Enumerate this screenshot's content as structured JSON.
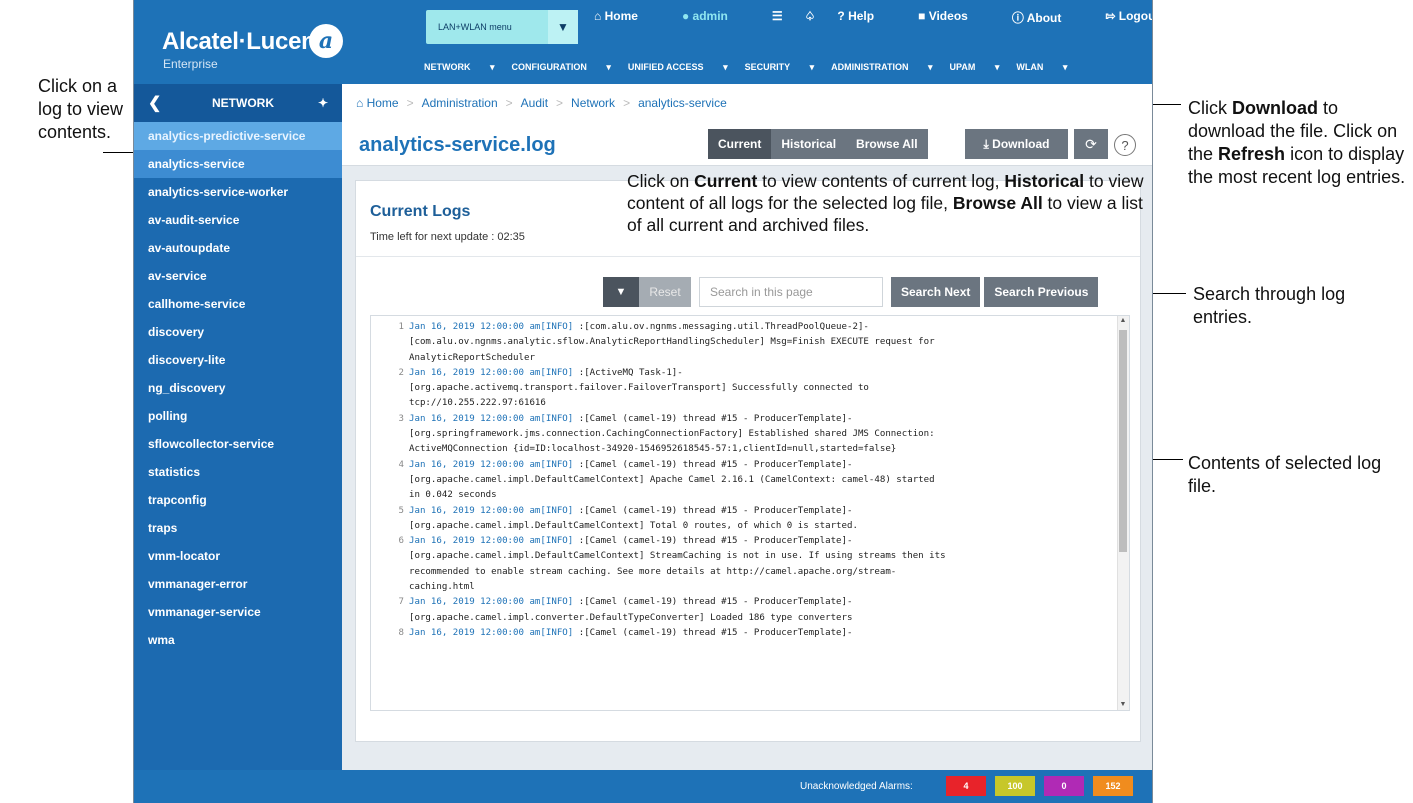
{
  "header": {
    "logo_text": "Alcatel·Lucent",
    "logo_sub": "Enterprise",
    "menu_select": "LAN+WLAN menu",
    "top_links": [
      "Home",
      "admin",
      "Help",
      "Videos",
      "About",
      "Logout"
    ],
    "main_menu": [
      "NETWORK",
      "CONFIGURATION",
      "UNIFIED ACCESS",
      "SECURITY",
      "ADMINISTRATION",
      "UPAM",
      "WLAN"
    ]
  },
  "sidebar": {
    "title": "NETWORK",
    "items": [
      "analytics-predictive-service",
      "analytics-service",
      "analytics-service-worker",
      "av-audit-service",
      "av-autoupdate",
      "av-service",
      "callhome-service",
      "discovery",
      "discovery-lite",
      "ng_discovery",
      "polling",
      "sflowcollector-service",
      "statistics",
      "trapconfig",
      "traps",
      "vmm-locator",
      "vmmanager-error",
      "vmmanager-service",
      "wma"
    ]
  },
  "breadcrumb": [
    "Home",
    "Administration",
    "Audit",
    "Network",
    "analytics-service"
  ],
  "page": {
    "title": "analytics-service.log",
    "segments": [
      "Current",
      "Historical",
      "Browse All"
    ],
    "download_label": "Download",
    "panel_title": "Current Logs",
    "update_label": "Time left for next update : 02:35",
    "reset_label": "Reset",
    "search_placeholder": "Search in this page",
    "search_next": "Search Next",
    "search_previous": "Search Previous"
  },
  "log": [
    {
      "n": "1",
      "ts": "Jan 16, 2019 12:00:00 am[INFO]",
      "text": " :[com.alu.ov.ngnms.messaging.util.ThreadPoolQueue-2]-\n[com.alu.ov.ngnms.analytic.sflow.AnalyticReportHandlingScheduler] Msg=Finish EXECUTE request for\nAnalyticReportScheduler"
    },
    {
      "n": "2",
      "ts": "Jan 16, 2019 12:00:00 am[INFO]",
      "text": " :[ActiveMQ Task-1]-\n[org.apache.activemq.transport.failover.FailoverTransport] Successfully connected to\ntcp://10.255.222.97:61616"
    },
    {
      "n": "3",
      "ts": "Jan 16, 2019 12:00:00 am[INFO]",
      "text": " :[Camel (camel-19) thread #15 - ProducerTemplate]-\n[org.springframework.jms.connection.CachingConnectionFactory] Established shared JMS Connection:\nActiveMQConnection {id=ID:localhost-34920-1546952618545-57:1,clientId=null,started=false}"
    },
    {
      "n": "4",
      "ts": "Jan 16, 2019 12:00:00 am[INFO]",
      "text": " :[Camel (camel-19) thread #15 - ProducerTemplate]-\n[org.apache.camel.impl.DefaultCamelContext] Apache Camel 2.16.1 (CamelContext: camel-48) started\nin 0.042 seconds"
    },
    {
      "n": "5",
      "ts": "Jan 16, 2019 12:00:00 am[INFO]",
      "text": " :[Camel (camel-19) thread #15 - ProducerTemplate]-\n[org.apache.camel.impl.DefaultCamelContext] Total 0 routes, of which 0 is started."
    },
    {
      "n": "6",
      "ts": "Jan 16, 2019 12:00:00 am[INFO]",
      "text": " :[Camel (camel-19) thread #15 - ProducerTemplate]-\n[org.apache.camel.impl.DefaultCamelContext] StreamCaching is not in use. If using streams then its\nrecommended to enable stream caching. See more details at http://camel.apache.org/stream-\ncaching.html"
    },
    {
      "n": "7",
      "ts": "Jan 16, 2019 12:00:00 am[INFO]",
      "text": " :[Camel (camel-19) thread #15 - ProducerTemplate]-\n[org.apache.camel.impl.converter.DefaultTypeConverter] Loaded 186 type converters"
    },
    {
      "n": "8",
      "ts": "Jan 16, 2019 12:00:00 am[INFO]",
      "text": " :[Camel (camel-19) thread #15 - ProducerTemplate]-"
    }
  ],
  "footer": {
    "alarms_label": "Unacknowledged Alarms:",
    "alarms": [
      {
        "value": "4",
        "color": "#e8232a"
      },
      {
        "value": "100",
        "color": "#c7c72a"
      },
      {
        "value": "0",
        "color": "#b02ab5"
      },
      {
        "value": "152",
        "color": "#f08c1e"
      }
    ]
  },
  "annotations": {
    "left": "Click on a log to view contents.",
    "download_1": "Click ",
    "download_b1": "Download",
    "download_2": " to download the file. Click on the ",
    "download_b2": "Refresh",
    "download_3": " icon to display the most recent log entries.",
    "current_b1": "Current",
    "current_1": "Click on ",
    "current_2": " to view contents of current log, ",
    "current_b2": "Historical",
    "current_3": " to view content of all logs for the selected log file, ",
    "current_b3": "Browse All",
    "current_4": " to view a list of all current and archived files.",
    "search": "Search through log entries.",
    "contents": "Contents of selected log file."
  }
}
